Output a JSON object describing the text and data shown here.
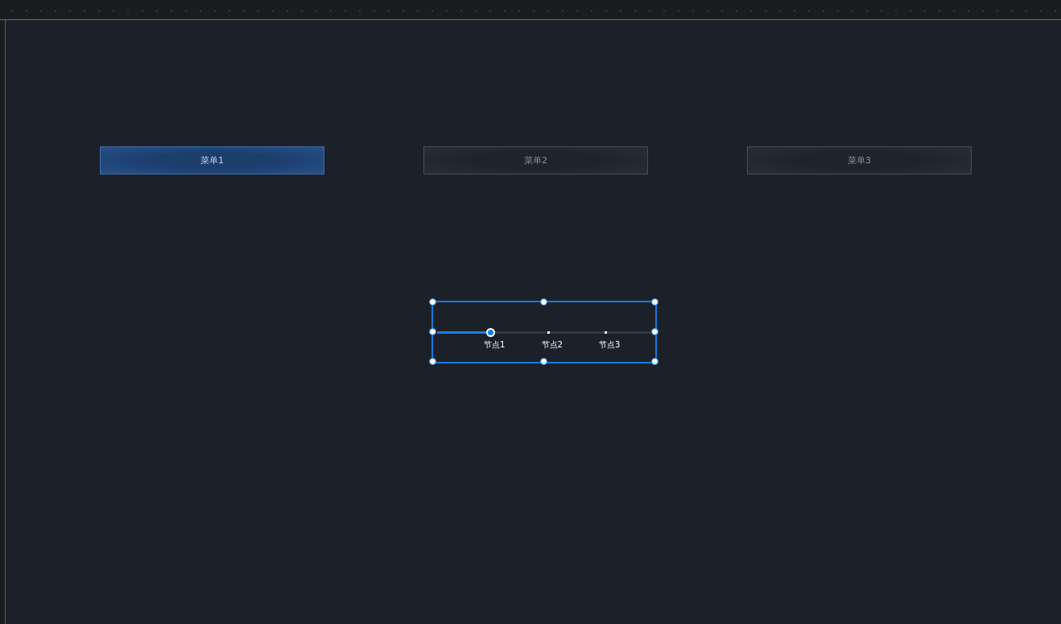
{
  "menus": [
    {
      "label": "菜单1",
      "selected": true
    },
    {
      "label": "菜单2",
      "selected": false
    },
    {
      "label": "菜单3",
      "selected": false
    }
  ],
  "timeline": {
    "level": 0.25,
    "nodes": [
      {
        "label": "节点1",
        "selected": true
      },
      {
        "label": "节点2",
        "selected": false
      },
      {
        "label": "节点3",
        "selected": false
      }
    ]
  }
}
